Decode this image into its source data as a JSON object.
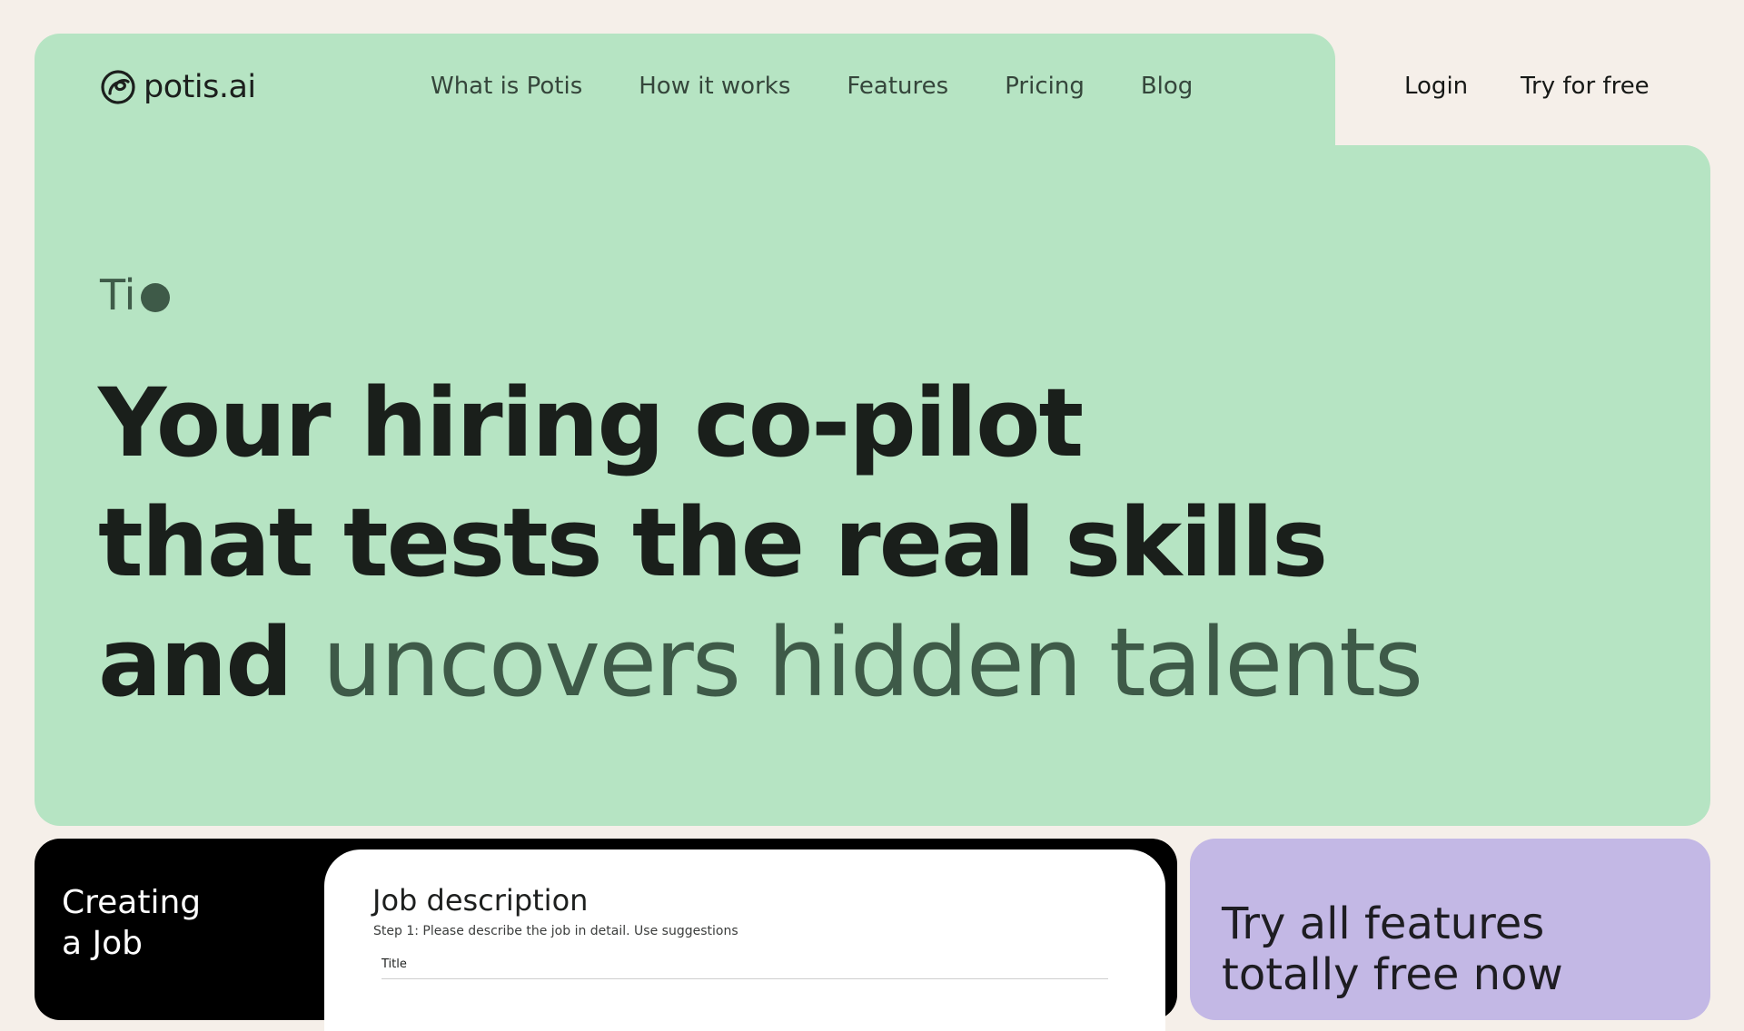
{
  "brand": {
    "name": "potis.ai",
    "logo_icon": "potis-logo-icon"
  },
  "nav": {
    "items": [
      {
        "label": "What is Potis"
      },
      {
        "label": "How it works"
      },
      {
        "label": "Features"
      },
      {
        "label": "Pricing"
      },
      {
        "label": "Blog"
      }
    ],
    "login_label": "Login",
    "try_label": "Try for free"
  },
  "hero": {
    "eyebrow": "Ti",
    "line1": "Your hiring co-pilot",
    "line2": "that tests the real skills",
    "line3_plain": "and",
    "line3_accent": "uncovers hidden talents"
  },
  "job_section": {
    "card_title": "Creating\na Job",
    "panel_title": "Job description",
    "panel_subtitle": "Step 1: Please describe the job in detail. Use suggestions",
    "field_label": "Title"
  },
  "promo": {
    "text": "Try all features totally free now"
  },
  "colors": {
    "background": "#f5efe9",
    "hero_green": "#b6e4c3",
    "accent_dark_green": "#3e5a48",
    "promo_purple": "#c3b8e5"
  }
}
